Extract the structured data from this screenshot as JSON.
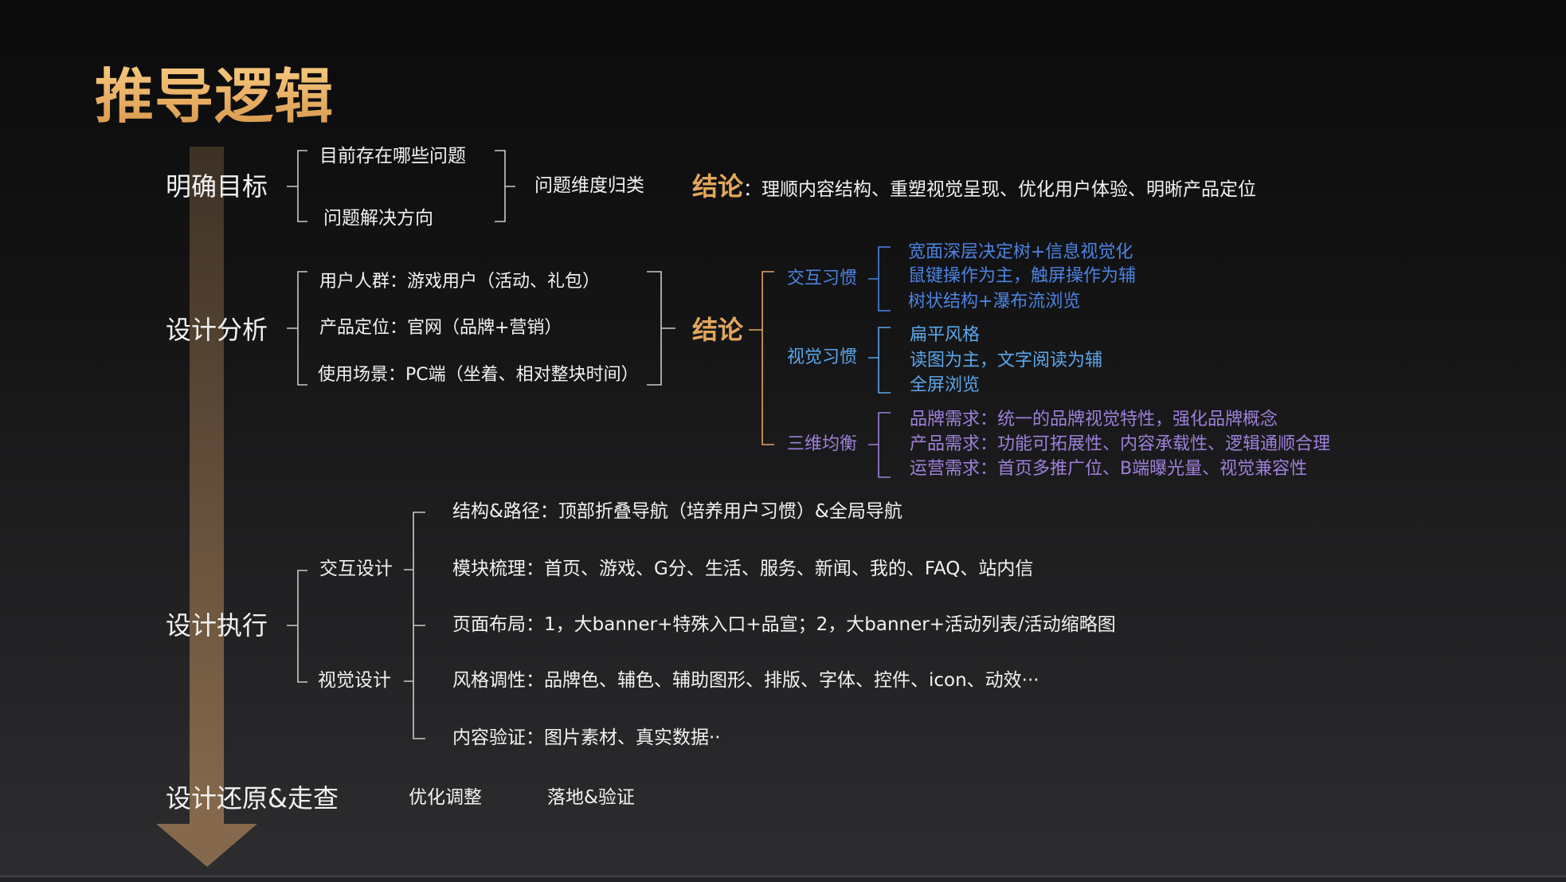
{
  "slide": {
    "title": "推导逻辑"
  },
  "colors": {
    "background_top": "#0b0b0c",
    "background_bottom": "#2d2d30",
    "title_gold": "#eab46a",
    "conclusion_gold": "#e2a75c",
    "text_white": "#f2f2f2",
    "connector_gray": "#c9c9c9",
    "interaction_blue": "#4c83e2",
    "visual_blue": "#5ca6ea",
    "balance_purple": "#9e80da",
    "arrow_brown": "#86694c"
  },
  "clarify_goal": {
    "heading": "明确目标",
    "questions": [
      "目前存在哪些问题",
      "问题解决方向"
    ],
    "classification": "问题维度归类",
    "conclusion_label": "结论",
    "conclusion_separator": "：",
    "conclusion_text": "理顺内容结构、重塑视觉呈现、优化用户体验、明晰产品定位"
  },
  "design_analysis": {
    "heading": "设计分析",
    "factors": [
      "用户人群：游戏用户（活动、礼包）",
      "产品定位：官网（品牌+营销）",
      "使用场景：PC端（坐着、相对整块时间）"
    ],
    "conclusion_label": "结论",
    "groups": [
      {
        "label": "交互习惯",
        "items": [
          "宽面深层决定树+信息视觉化",
          "鼠键操作为主，触屏操作为辅",
          "树状结构+瀑布流浏览"
        ]
      },
      {
        "label": "视觉习惯",
        "items": [
          "扁平风格",
          "读图为主，文字阅读为辅",
          "全屏浏览"
        ]
      },
      {
        "label": "三维均衡",
        "items": [
          "品牌需求：统一的品牌视觉特性，强化品牌概念",
          "产品需求：功能可拓展性、内容承载性、逻辑通顺合理",
          "运营需求：首页多推广位、B端曝光量、视觉兼容性"
        ]
      }
    ]
  },
  "design_execution": {
    "heading": "设计执行",
    "branches": [
      "交互设计",
      "视觉设计"
    ],
    "items": [
      "结构&路径：顶部折叠导航（培养用户习惯）&全局导航",
      "模块梳理：首页、游戏、G分、生活、服务、新闻、我的、FAQ、站内信",
      "页面布局：1，大banner+特殊入口+品宣；2，大banner+活动列表/活动缩略图",
      "风格调性：品牌色、辅色、辅助图形、排版、字体、控件、icon、动效···",
      "内容验证：图片素材、真实数据··"
    ]
  },
  "restore_review": {
    "heading": "设计还原&走查",
    "steps": [
      "优化调整",
      "落地&验证"
    ]
  }
}
